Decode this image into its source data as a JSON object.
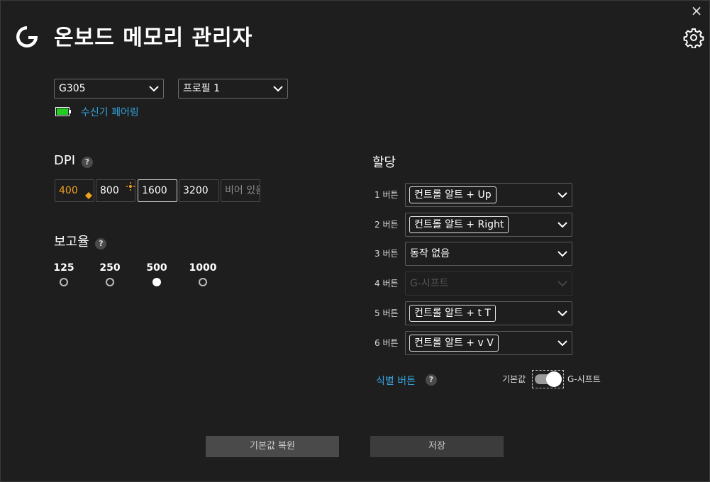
{
  "window": {
    "title": "온보드 메모리 관리자",
    "close_glyph": "×"
  },
  "device": {
    "selected": "G305"
  },
  "profile": {
    "selected": "프로필 1"
  },
  "battery": {
    "color": "#22cc22"
  },
  "receiver_pairing": "수신기 페어링",
  "dpi": {
    "title": "DPI",
    "help": "?",
    "levels": [
      "400",
      "800",
      "1600",
      "3200",
      "비어 있음"
    ]
  },
  "report_rate": {
    "title": "보고율",
    "help": "?",
    "options": [
      "125",
      "250",
      "500",
      "1000"
    ],
    "selected": "500"
  },
  "assignments": {
    "title": "할당",
    "buttons": [
      {
        "label": "1 버튼",
        "value": "컨트롤 알트 + Up"
      },
      {
        "label": "2 버튼",
        "value": "컨트롤 알트 + Right"
      },
      {
        "label": "3 버튼",
        "value": "동작 없음"
      },
      {
        "label": "4 버튼",
        "value": "G-시프트"
      },
      {
        "label": "5 버튼",
        "value": "컨트롤 알트 + t T"
      },
      {
        "label": "6 버튼",
        "value": "컨트롤 알트 + v V"
      }
    ]
  },
  "identify_buttons": {
    "label": "식별 버튼",
    "help": "?"
  },
  "mode_toggle": {
    "left_label": "기본값",
    "right_label": "G-시프트"
  },
  "actions": {
    "reset": "기본값 복원",
    "save": "저장"
  },
  "colors": {
    "accent": "#34a3e0",
    "dpi_active": "#f0a21c"
  }
}
